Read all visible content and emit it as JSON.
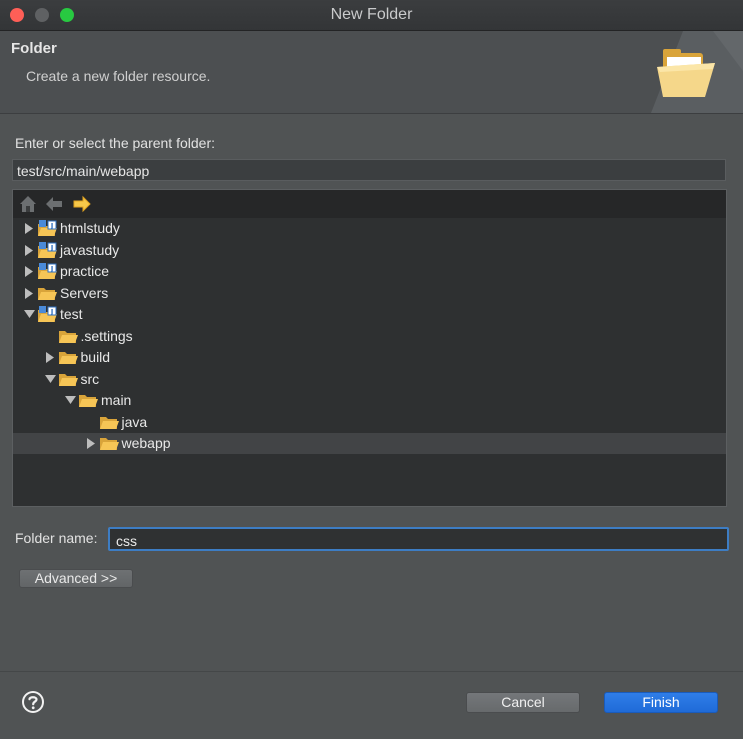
{
  "window": {
    "title": "New Folder"
  },
  "banner": {
    "title": "Folder",
    "description": "Create a new folder resource.",
    "icon": "open-folder-icon"
  },
  "parent": {
    "label": "Enter or select the parent folder:",
    "value": "test/src/main/webapp"
  },
  "tree": {
    "toolbar": [
      "home-icon",
      "back-arrow-icon",
      "forward-arrow-icon"
    ],
    "rows": [
      {
        "label": "htmlstudy",
        "depth": 0,
        "state": "collapsed",
        "icon": "project-icon"
      },
      {
        "label": "javastudy",
        "depth": 0,
        "state": "collapsed",
        "icon": "project-icon"
      },
      {
        "label": "practice",
        "depth": 0,
        "state": "collapsed",
        "icon": "project-icon"
      },
      {
        "label": "Servers",
        "depth": 0,
        "state": "collapsed",
        "icon": "folder-icon"
      },
      {
        "label": "test",
        "depth": 0,
        "state": "expanded",
        "icon": "project-icon"
      },
      {
        "label": ".settings",
        "depth": 1,
        "state": "leaf",
        "icon": "folder-icon"
      },
      {
        "label": "build",
        "depth": 1,
        "state": "collapsed",
        "icon": "folder-icon"
      },
      {
        "label": "src",
        "depth": 1,
        "state": "expanded",
        "icon": "folder-icon"
      },
      {
        "label": "main",
        "depth": 2,
        "state": "expanded",
        "icon": "folder-icon"
      },
      {
        "label": "java",
        "depth": 3,
        "state": "leaf",
        "icon": "folder-icon"
      },
      {
        "label": "webapp",
        "depth": 3,
        "state": "collapsed",
        "icon": "folder-icon",
        "selected": true
      }
    ]
  },
  "folder_name": {
    "label": "Folder name:",
    "value": "css"
  },
  "buttons": {
    "advanced": "Advanced >>",
    "cancel": "Cancel",
    "finish": "Finish",
    "help_icon": "help-icon"
  },
  "colors": {
    "accent": "#2f7ee8",
    "focus_ring": "#3d7dc4",
    "folder": "#f3c14e"
  }
}
